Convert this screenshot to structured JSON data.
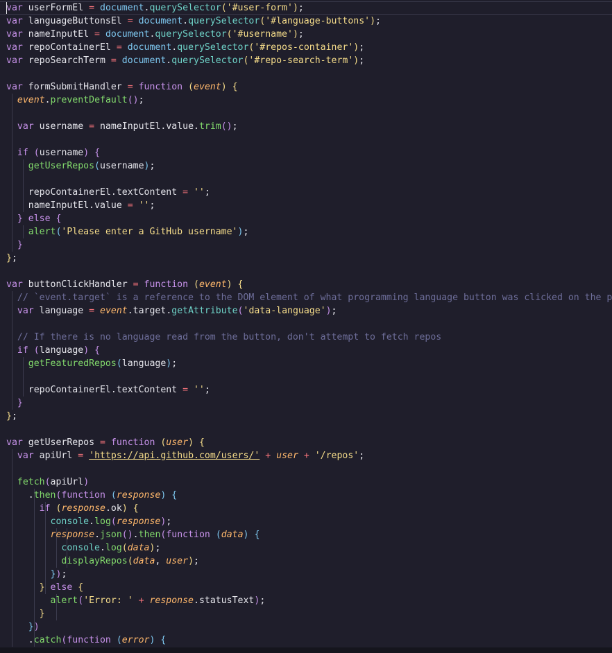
{
  "lines": [
    [
      [
        "kw",
        "var"
      ],
      [
        "var",
        " userFormEl "
      ],
      [
        "op",
        "="
      ],
      [
        "doc",
        " document"
      ],
      [
        "punc",
        "."
      ],
      [
        "method",
        "querySelector"
      ],
      [
        "bracket1",
        "("
      ],
      [
        "str",
        "'#user-form'"
      ],
      [
        "bracket1",
        ")"
      ],
      [
        "punc",
        ";"
      ]
    ],
    [
      [
        "kw",
        "var"
      ],
      [
        "var",
        " languageButtonsEl "
      ],
      [
        "op",
        "="
      ],
      [
        "doc",
        " document"
      ],
      [
        "punc",
        "."
      ],
      [
        "method",
        "querySelector"
      ],
      [
        "bracket1",
        "("
      ],
      [
        "str",
        "'#language-buttons'"
      ],
      [
        "bracket1",
        ")"
      ],
      [
        "punc",
        ";"
      ]
    ],
    [
      [
        "kw",
        "var"
      ],
      [
        "var",
        " nameInputEl "
      ],
      [
        "op",
        "="
      ],
      [
        "doc",
        " document"
      ],
      [
        "punc",
        "."
      ],
      [
        "method",
        "querySelector"
      ],
      [
        "bracket1",
        "("
      ],
      [
        "str",
        "'#username'"
      ],
      [
        "bracket1",
        ")"
      ],
      [
        "punc",
        ";"
      ]
    ],
    [
      [
        "kw",
        "var"
      ],
      [
        "var",
        " repoContainerEl "
      ],
      [
        "op",
        "="
      ],
      [
        "doc",
        " document"
      ],
      [
        "punc",
        "."
      ],
      [
        "method",
        "querySelector"
      ],
      [
        "bracket1",
        "("
      ],
      [
        "str",
        "'#repos-container'"
      ],
      [
        "bracket1",
        ")"
      ],
      [
        "punc",
        ";"
      ]
    ],
    [
      [
        "kw",
        "var"
      ],
      [
        "var",
        " repoSearchTerm "
      ],
      [
        "op",
        "="
      ],
      [
        "doc",
        " document"
      ],
      [
        "punc",
        "."
      ],
      [
        "method",
        "querySelector"
      ],
      [
        "bracket1",
        "("
      ],
      [
        "str",
        "'#repo-search-term'"
      ],
      [
        "bracket1",
        ")"
      ],
      [
        "punc",
        ";"
      ]
    ],
    [],
    [
      [
        "kw",
        "var"
      ],
      [
        "var",
        " formSubmitHandler "
      ],
      [
        "op",
        "="
      ],
      [
        "kw",
        " function "
      ],
      [
        "bracket1",
        "("
      ],
      [
        "param",
        "event"
      ],
      [
        "bracket1",
        ")"
      ],
      [
        "punc",
        " "
      ],
      [
        "bracket1",
        "{"
      ]
    ],
    [
      [
        "punc",
        "  "
      ],
      [
        "param",
        "event"
      ],
      [
        "punc",
        "."
      ],
      [
        "fn",
        "preventDefault"
      ],
      [
        "bracket2",
        "()"
      ],
      [
        "punc",
        ";"
      ]
    ],
    [],
    [
      [
        "punc",
        "  "
      ],
      [
        "kw",
        "var"
      ],
      [
        "var",
        " username "
      ],
      [
        "op",
        "="
      ],
      [
        "var",
        " nameInputEl"
      ],
      [
        "punc",
        "."
      ],
      [
        "prop",
        "value"
      ],
      [
        "punc",
        "."
      ],
      [
        "fn",
        "trim"
      ],
      [
        "bracket2",
        "()"
      ],
      [
        "punc",
        ";"
      ]
    ],
    [],
    [
      [
        "punc",
        "  "
      ],
      [
        "kw",
        "if"
      ],
      [
        "punc",
        " "
      ],
      [
        "bracket2",
        "("
      ],
      [
        "var",
        "username"
      ],
      [
        "bracket2",
        ")"
      ],
      [
        "punc",
        " "
      ],
      [
        "bracket2",
        "{"
      ]
    ],
    [
      [
        "punc",
        "    "
      ],
      [
        "fn",
        "getUserRepos"
      ],
      [
        "bracket3",
        "("
      ],
      [
        "var",
        "username"
      ],
      [
        "bracket3",
        ")"
      ],
      [
        "punc",
        ";"
      ]
    ],
    [],
    [
      [
        "punc",
        "    "
      ],
      [
        "var",
        "repoContainerEl"
      ],
      [
        "punc",
        "."
      ],
      [
        "prop",
        "textContent"
      ],
      [
        "op",
        " = "
      ],
      [
        "str",
        "''"
      ],
      [
        "punc",
        ";"
      ]
    ],
    [
      [
        "punc",
        "    "
      ],
      [
        "var",
        "nameInputEl"
      ],
      [
        "punc",
        "."
      ],
      [
        "prop",
        "value"
      ],
      [
        "op",
        " = "
      ],
      [
        "str",
        "''"
      ],
      [
        "punc",
        ";"
      ]
    ],
    [
      [
        "punc",
        "  "
      ],
      [
        "bracket2",
        "}"
      ],
      [
        "kw",
        " else "
      ],
      [
        "bracket2",
        "{"
      ]
    ],
    [
      [
        "punc",
        "    "
      ],
      [
        "fn",
        "alert"
      ],
      [
        "bracket3",
        "("
      ],
      [
        "str",
        "'Please enter a GitHub username'"
      ],
      [
        "bracket3",
        ")"
      ],
      [
        "punc",
        ";"
      ]
    ],
    [
      [
        "punc",
        "  "
      ],
      [
        "bracket2",
        "}"
      ]
    ],
    [
      [
        "bracket1",
        "}"
      ],
      [
        "punc",
        ";"
      ]
    ],
    [],
    [
      [
        "kw",
        "var"
      ],
      [
        "var",
        " buttonClickHandler "
      ],
      [
        "op",
        "="
      ],
      [
        "kw",
        " function "
      ],
      [
        "bracket1",
        "("
      ],
      [
        "param",
        "event"
      ],
      [
        "bracket1",
        ")"
      ],
      [
        "punc",
        " "
      ],
      [
        "bracket1",
        "{"
      ]
    ],
    [
      [
        "punc",
        "  "
      ],
      [
        "cmt",
        "// `event.target` is a reference to the DOM element of what programming language button was clicked on the page"
      ]
    ],
    [
      [
        "punc",
        "  "
      ],
      [
        "kw",
        "var"
      ],
      [
        "var",
        " language "
      ],
      [
        "op",
        "="
      ],
      [
        "param",
        " event"
      ],
      [
        "punc",
        "."
      ],
      [
        "prop",
        "target"
      ],
      [
        "punc",
        "."
      ],
      [
        "method",
        "getAttribute"
      ],
      [
        "bracket2",
        "("
      ],
      [
        "str",
        "'data-language'"
      ],
      [
        "bracket2",
        ")"
      ],
      [
        "punc",
        ";"
      ]
    ],
    [],
    [
      [
        "punc",
        "  "
      ],
      [
        "cmt",
        "// If there is no language read from the button, don't attempt to fetch repos"
      ]
    ],
    [
      [
        "punc",
        "  "
      ],
      [
        "kw",
        "if"
      ],
      [
        "punc",
        " "
      ],
      [
        "bracket2",
        "("
      ],
      [
        "var",
        "language"
      ],
      [
        "bracket2",
        ")"
      ],
      [
        "punc",
        " "
      ],
      [
        "bracket2",
        "{"
      ]
    ],
    [
      [
        "punc",
        "    "
      ],
      [
        "fn",
        "getFeaturedRepos"
      ],
      [
        "bracket3",
        "("
      ],
      [
        "var",
        "language"
      ],
      [
        "bracket3",
        ")"
      ],
      [
        "punc",
        ";"
      ]
    ],
    [],
    [
      [
        "punc",
        "    "
      ],
      [
        "var",
        "repoContainerEl"
      ],
      [
        "punc",
        "."
      ],
      [
        "prop",
        "textContent"
      ],
      [
        "op",
        " = "
      ],
      [
        "str",
        "''"
      ],
      [
        "punc",
        ";"
      ]
    ],
    [
      [
        "punc",
        "  "
      ],
      [
        "bracket2",
        "}"
      ]
    ],
    [
      [
        "bracket1",
        "}"
      ],
      [
        "punc",
        ";"
      ]
    ],
    [],
    [
      [
        "kw",
        "var"
      ],
      [
        "var",
        " getUserRepos "
      ],
      [
        "op",
        "="
      ],
      [
        "kw",
        " function "
      ],
      [
        "bracket1",
        "("
      ],
      [
        "param",
        "user"
      ],
      [
        "bracket1",
        ")"
      ],
      [
        "punc",
        " "
      ],
      [
        "bracket1",
        "{"
      ]
    ],
    [
      [
        "punc",
        "  "
      ],
      [
        "kw",
        "var"
      ],
      [
        "var",
        " apiUrl "
      ],
      [
        "op",
        "="
      ],
      [
        "punc",
        " "
      ],
      [
        "url",
        "'https://api.github.com/users/'"
      ],
      [
        "op",
        " + "
      ],
      [
        "param",
        "user"
      ],
      [
        "op",
        " + "
      ],
      [
        "str",
        "'/repos'"
      ],
      [
        "punc",
        ";"
      ]
    ],
    [],
    [
      [
        "punc",
        "  "
      ],
      [
        "fn",
        "fetch"
      ],
      [
        "bracket2",
        "("
      ],
      [
        "var",
        "apiUrl"
      ],
      [
        "bracket2",
        ")"
      ]
    ],
    [
      [
        "punc",
        "    ."
      ],
      [
        "fn",
        "then"
      ],
      [
        "bracket2",
        "("
      ],
      [
        "kw",
        "function"
      ],
      [
        "punc",
        " "
      ],
      [
        "bracket3",
        "("
      ],
      [
        "param",
        "response"
      ],
      [
        "bracket3",
        ")"
      ],
      [
        "punc",
        " "
      ],
      [
        "bracket3",
        "{"
      ]
    ],
    [
      [
        "punc",
        "      "
      ],
      [
        "kw",
        "if"
      ],
      [
        "punc",
        " "
      ],
      [
        "bracket1",
        "("
      ],
      [
        "param",
        "response"
      ],
      [
        "punc",
        "."
      ],
      [
        "prop",
        "ok"
      ],
      [
        "bracket1",
        ")"
      ],
      [
        "punc",
        " "
      ],
      [
        "bracket1",
        "{"
      ]
    ],
    [
      [
        "punc",
        "        "
      ],
      [
        "console",
        "console"
      ],
      [
        "punc",
        "."
      ],
      [
        "fn",
        "log"
      ],
      [
        "bracket2",
        "("
      ],
      [
        "param",
        "response"
      ],
      [
        "bracket2",
        ")"
      ],
      [
        "punc",
        ";"
      ]
    ],
    [
      [
        "punc",
        "        "
      ],
      [
        "param",
        "response"
      ],
      [
        "punc",
        "."
      ],
      [
        "fn",
        "json"
      ],
      [
        "bracket2",
        "()"
      ],
      [
        "punc",
        "."
      ],
      [
        "fn",
        "then"
      ],
      [
        "bracket2",
        "("
      ],
      [
        "kw",
        "function"
      ],
      [
        "punc",
        " "
      ],
      [
        "bracket3",
        "("
      ],
      [
        "param",
        "data"
      ],
      [
        "bracket3",
        ")"
      ],
      [
        "punc",
        " "
      ],
      [
        "bracket3",
        "{"
      ]
    ],
    [
      [
        "punc",
        "          "
      ],
      [
        "console",
        "console"
      ],
      [
        "punc",
        "."
      ],
      [
        "fn",
        "log"
      ],
      [
        "bracket1",
        "("
      ],
      [
        "param",
        "data"
      ],
      [
        "bracket1",
        ")"
      ],
      [
        "punc",
        ";"
      ]
    ],
    [
      [
        "punc",
        "          "
      ],
      [
        "fn",
        "displayRepos"
      ],
      [
        "bracket1",
        "("
      ],
      [
        "param",
        "data"
      ],
      [
        "punc",
        ", "
      ],
      [
        "param",
        "user"
      ],
      [
        "bracket1",
        ")"
      ],
      [
        "punc",
        ";"
      ]
    ],
    [
      [
        "punc",
        "        "
      ],
      [
        "bracket3",
        "}"
      ],
      [
        "bracket2",
        ")"
      ],
      [
        "punc",
        ";"
      ]
    ],
    [
      [
        "punc",
        "      "
      ],
      [
        "bracket1",
        "}"
      ],
      [
        "kw",
        " else "
      ],
      [
        "bracket1",
        "{"
      ]
    ],
    [
      [
        "punc",
        "        "
      ],
      [
        "fn",
        "alert"
      ],
      [
        "bracket2",
        "("
      ],
      [
        "str",
        "'Error: '"
      ],
      [
        "op",
        " + "
      ],
      [
        "param",
        "response"
      ],
      [
        "punc",
        "."
      ],
      [
        "prop",
        "statusText"
      ],
      [
        "bracket2",
        ")"
      ],
      [
        "punc",
        ";"
      ]
    ],
    [
      [
        "punc",
        "      "
      ],
      [
        "bracket1",
        "}"
      ]
    ],
    [
      [
        "punc",
        "    "
      ],
      [
        "bracket3",
        "}"
      ],
      [
        "bracket2",
        ")"
      ]
    ],
    [
      [
        "punc",
        "    ."
      ],
      [
        "fn",
        "catch"
      ],
      [
        "bracket2",
        "("
      ],
      [
        "kw",
        "function"
      ],
      [
        "punc",
        " "
      ],
      [
        "bracket3",
        "("
      ],
      [
        "param",
        "error"
      ],
      [
        "bracket3",
        ")"
      ],
      [
        "punc",
        " "
      ],
      [
        "bracket3",
        "{"
      ]
    ]
  ]
}
